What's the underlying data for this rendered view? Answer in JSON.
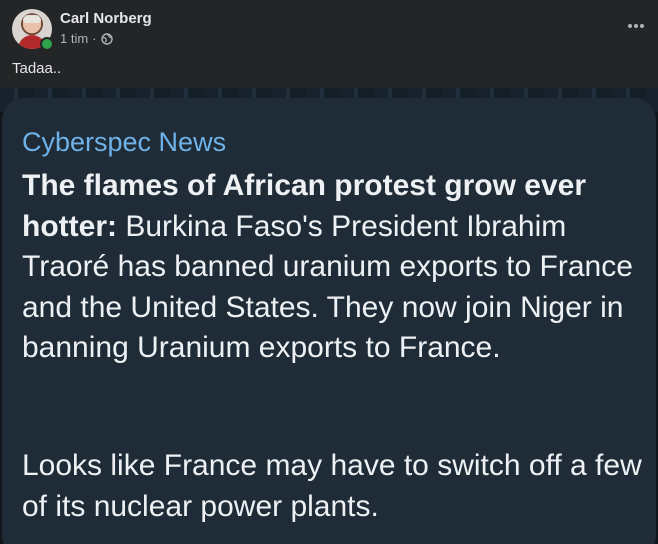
{
  "post": {
    "author": "Carl Norberg",
    "time": "1 tim",
    "separator": "·",
    "caption": "Tadaa..",
    "more_label": "..."
  },
  "icons": {
    "avatar": "profile-photo",
    "online": "online-status-dot",
    "audience": "globe-icon",
    "more": "more-options-icon"
  },
  "news_card": {
    "source": "Cyberspec News",
    "headline_bold": "The flames of African protest grow ever hotter:",
    "headline_rest": " Burkina Faso's President Ibrahim Traoré has banned uranium exports to France and the United States. They now join Niger in banning Uranium exports to France.",
    "paragraph_2": "Looks like France may have to switch off a few of its nuclear power plants."
  },
  "colors": {
    "background": "#242526",
    "text_primary": "#e4e6eb",
    "text_secondary": "#b0b3b8",
    "online": "#31a24c",
    "card": "#1f2c38",
    "source_blue": "#6fb2e8"
  }
}
